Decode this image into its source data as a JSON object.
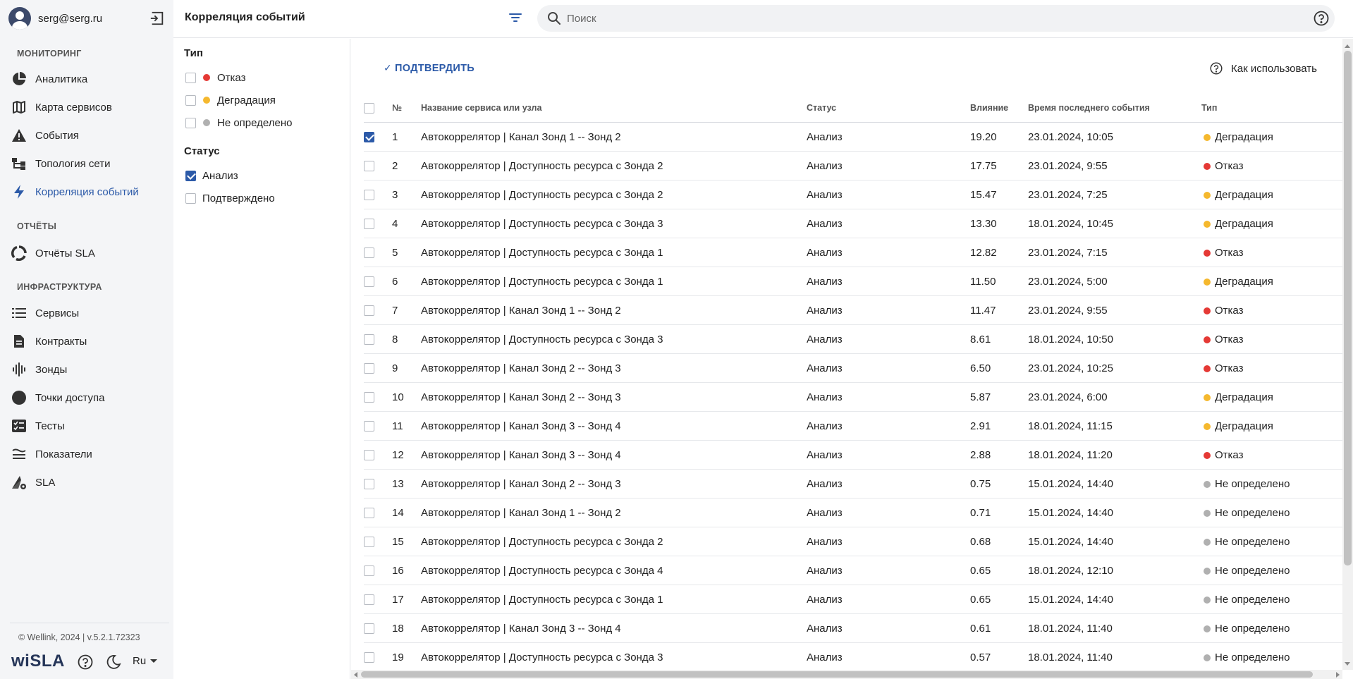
{
  "user": {
    "email": "serg@serg.ru"
  },
  "sidebar": {
    "sections": {
      "monitoring": "МОНИТОРИНГ",
      "reports": "ОТЧЁТЫ",
      "infrastructure": "ИНФРАСТРУКТУРА"
    },
    "items": [
      {
        "label": "Аналитика",
        "icon": "pie-chart-icon"
      },
      {
        "label": "Карта сервисов",
        "icon": "map-icon"
      },
      {
        "label": "События",
        "icon": "warning-icon"
      },
      {
        "label": "Топология сети",
        "icon": "topology-icon"
      },
      {
        "label": "Корреляция событий",
        "icon": "lightning-icon",
        "active": true
      },
      {
        "label": "Отчёты SLA",
        "icon": "donut-icon"
      },
      {
        "label": "Сервисы",
        "icon": "list-icon"
      },
      {
        "label": "Контракты",
        "icon": "document-icon"
      },
      {
        "label": "Зонды",
        "icon": "waveform-icon"
      },
      {
        "label": "Точки доступа",
        "icon": "circle-icon"
      },
      {
        "label": "Тесты",
        "icon": "checklist-icon"
      },
      {
        "label": "Показатели",
        "icon": "metrics-icon"
      },
      {
        "label": "SLA",
        "icon": "sla-gear-icon"
      }
    ],
    "footer": {
      "copyright": "© Wellink, 2024 | v.5.2.1.72323",
      "brand": "wiSLA",
      "language": "Ru"
    }
  },
  "header": {
    "title": "Корреляция событий",
    "search_placeholder": "Поиск"
  },
  "filters": {
    "type_title": "Тип",
    "type_options": [
      {
        "label": "Отказ",
        "color": "#e53935",
        "checked": false
      },
      {
        "label": "Деградация",
        "color": "#f5b82e",
        "checked": false
      },
      {
        "label": "Не определено",
        "color": "#b0b0b0",
        "checked": false
      }
    ],
    "status_title": "Статус",
    "status_options": [
      {
        "label": "Анализ",
        "checked": true
      },
      {
        "label": "Подтверждено",
        "checked": false
      }
    ]
  },
  "toolbar": {
    "confirm_label": "ПОДТВЕРДИТЬ",
    "howto_label": "Как использовать"
  },
  "colors": {
    "accent": "#2c5aa8",
    "fail": "#e53935",
    "degradation": "#f5b82e",
    "undefined": "#b0b0b0"
  },
  "table": {
    "columns": {
      "num": "№",
      "name": "Название сервиса или узла",
      "status": "Статус",
      "impact": "Влияние",
      "time": "Время последнего события",
      "type": "Тип"
    },
    "rows": [
      {
        "num": "1",
        "name": "Автокоррелятор | Канал Зонд 1 -- Зонд 2",
        "status": "Анализ",
        "impact": "19.20",
        "time": "23.01.2024, 10:05",
        "type": "Деградация",
        "type_color": "#f5b82e",
        "checked": true
      },
      {
        "num": "2",
        "name": "Автокоррелятор | Доступность ресурса с Зонда 2",
        "status": "Анализ",
        "impact": "17.75",
        "time": "23.01.2024, 9:55",
        "type": "Отказ",
        "type_color": "#e53935",
        "checked": false
      },
      {
        "num": "3",
        "name": "Автокоррелятор | Доступность ресурса с Зонда 2",
        "status": "Анализ",
        "impact": "15.47",
        "time": "23.01.2024, 7:25",
        "type": "Деградация",
        "type_color": "#f5b82e",
        "checked": false
      },
      {
        "num": "4",
        "name": "Автокоррелятор | Доступность ресурса с Зонда 3",
        "status": "Анализ",
        "impact": "13.30",
        "time": "18.01.2024, 10:45",
        "type": "Деградация",
        "type_color": "#f5b82e",
        "checked": false
      },
      {
        "num": "5",
        "name": "Автокоррелятор | Доступность ресурса с Зонда 1",
        "status": "Анализ",
        "impact": "12.82",
        "time": "23.01.2024, 7:15",
        "type": "Отказ",
        "type_color": "#e53935",
        "checked": false
      },
      {
        "num": "6",
        "name": "Автокоррелятор | Доступность ресурса с Зонда 1",
        "status": "Анализ",
        "impact": "11.50",
        "time": "23.01.2024, 5:00",
        "type": "Деградация",
        "type_color": "#f5b82e",
        "checked": false
      },
      {
        "num": "7",
        "name": "Автокоррелятор | Канал Зонд 1 -- Зонд 2",
        "status": "Анализ",
        "impact": "11.47",
        "time": "23.01.2024, 9:55",
        "type": "Отказ",
        "type_color": "#e53935",
        "checked": false
      },
      {
        "num": "8",
        "name": "Автокоррелятор | Доступность ресурса с Зонда 3",
        "status": "Анализ",
        "impact": "8.61",
        "time": "18.01.2024, 10:50",
        "type": "Отказ",
        "type_color": "#e53935",
        "checked": false
      },
      {
        "num": "9",
        "name": "Автокоррелятор | Канал Зонд 2 -- Зонд 3",
        "status": "Анализ",
        "impact": "6.50",
        "time": "23.01.2024, 10:25",
        "type": "Отказ",
        "type_color": "#e53935",
        "checked": false
      },
      {
        "num": "10",
        "name": "Автокоррелятор | Канал Зонд 2 -- Зонд 3",
        "status": "Анализ",
        "impact": "5.87",
        "time": "23.01.2024, 6:00",
        "type": "Деградация",
        "type_color": "#f5b82e",
        "checked": false
      },
      {
        "num": "11",
        "name": "Автокоррелятор | Канал Зонд 3 -- Зонд 4",
        "status": "Анализ",
        "impact": "2.91",
        "time": "18.01.2024, 11:15",
        "type": "Деградация",
        "type_color": "#f5b82e",
        "checked": false
      },
      {
        "num": "12",
        "name": "Автокоррелятор | Канал Зонд 3 -- Зонд 4",
        "status": "Анализ",
        "impact": "2.88",
        "time": "18.01.2024, 11:20",
        "type": "Отказ",
        "type_color": "#e53935",
        "checked": false
      },
      {
        "num": "13",
        "name": "Автокоррелятор | Канал Зонд 2 -- Зонд 3",
        "status": "Анализ",
        "impact": "0.75",
        "time": "15.01.2024, 14:40",
        "type": "Не определено",
        "type_color": "#b0b0b0",
        "checked": false
      },
      {
        "num": "14",
        "name": "Автокоррелятор | Канал Зонд 1 -- Зонд 2",
        "status": "Анализ",
        "impact": "0.71",
        "time": "15.01.2024, 14:40",
        "type": "Не определено",
        "type_color": "#b0b0b0",
        "checked": false
      },
      {
        "num": "15",
        "name": "Автокоррелятор | Доступность ресурса с Зонда 2",
        "status": "Анализ",
        "impact": "0.68",
        "time": "15.01.2024, 14:40",
        "type": "Не определено",
        "type_color": "#b0b0b0",
        "checked": false
      },
      {
        "num": "16",
        "name": "Автокоррелятор | Доступность ресурса с Зонда 4",
        "status": "Анализ",
        "impact": "0.65",
        "time": "18.01.2024, 12:10",
        "type": "Не определено",
        "type_color": "#b0b0b0",
        "checked": false
      },
      {
        "num": "17",
        "name": "Автокоррелятор | Доступность ресурса с Зонда 1",
        "status": "Анализ",
        "impact": "0.65",
        "time": "15.01.2024, 14:40",
        "type": "Не определено",
        "type_color": "#b0b0b0",
        "checked": false
      },
      {
        "num": "18",
        "name": "Автокоррелятор | Канал Зонд 3 -- Зонд 4",
        "status": "Анализ",
        "impact": "0.61",
        "time": "18.01.2024, 11:40",
        "type": "Не определено",
        "type_color": "#b0b0b0",
        "checked": false
      },
      {
        "num": "19",
        "name": "Автокоррелятор | Доступность ресурса с Зонда 3",
        "status": "Анализ",
        "impact": "0.57",
        "time": "18.01.2024, 11:40",
        "type": "Не определено",
        "type_color": "#b0b0b0",
        "checked": false
      }
    ]
  }
}
